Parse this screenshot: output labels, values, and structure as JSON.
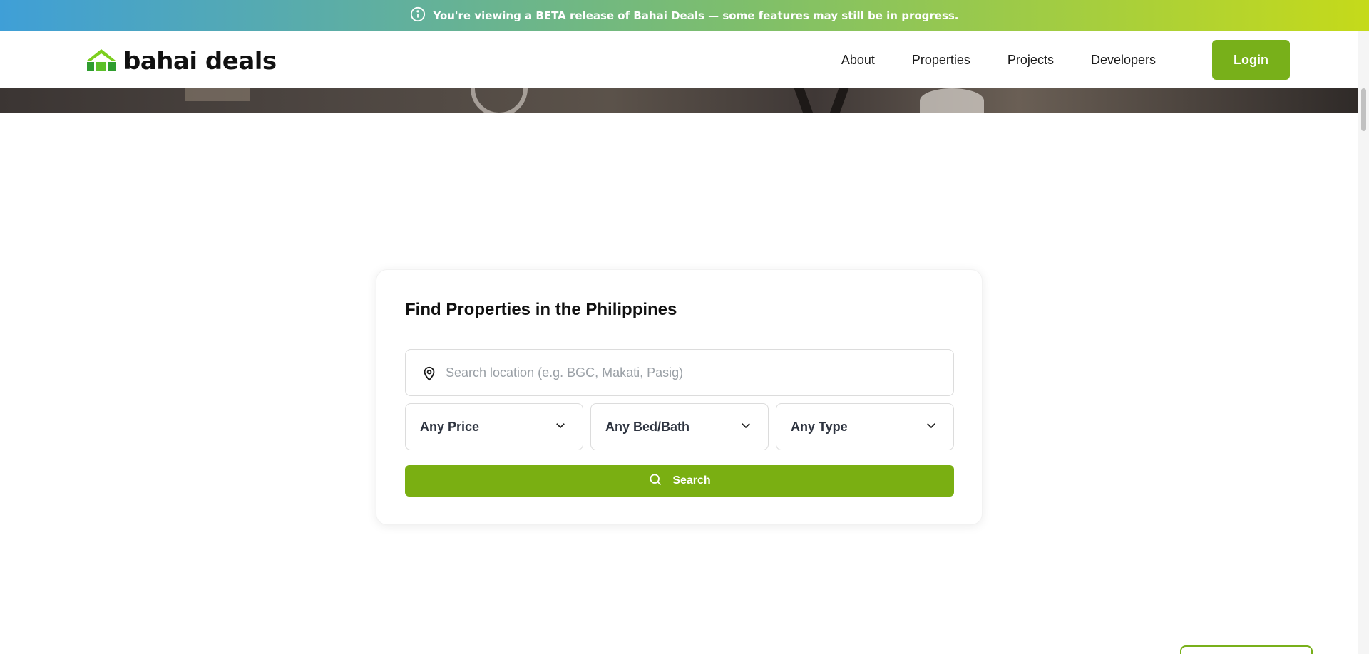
{
  "beta_banner": {
    "icon": "info-icon",
    "text": "You're viewing a BETA release of Bahai Deals — some features may still be in progress."
  },
  "header": {
    "logo_text": "bahai deals",
    "nav": [
      {
        "label": "About"
      },
      {
        "label": "Properties"
      },
      {
        "label": "Projects"
      },
      {
        "label": "Developers"
      }
    ],
    "login_label": "Login"
  },
  "search": {
    "title": "Find Properties in the Philippines",
    "location_placeholder": "Search location (e.g. BGC, Makati, Pasig)",
    "location_value": "",
    "price": "Any Price",
    "bed_bath": "Any Bed/Bath",
    "type": "Any Type",
    "button_label": "Search"
  },
  "colors": {
    "accent": "#78b01a",
    "banner_start": "#3f9fd7",
    "banner_end": "#c5da1a"
  }
}
